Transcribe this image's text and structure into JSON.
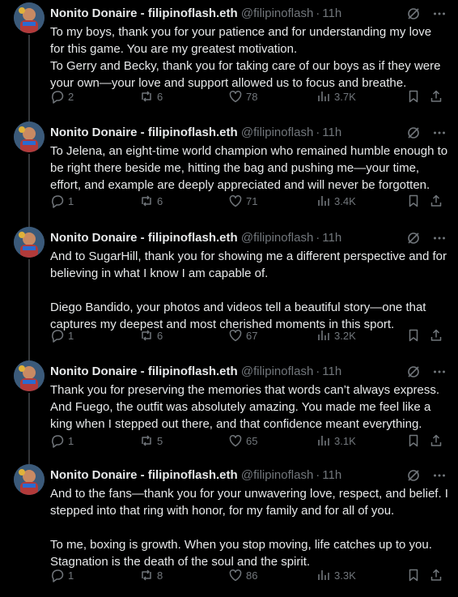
{
  "author": {
    "name": "Nonito Donaire - filipinoflash.eth",
    "handle": "@filipinoflash",
    "separator": "·",
    "time": "11h"
  },
  "colors": {
    "background": "#000000",
    "text": "#e7e9ea",
    "muted": "#71767b",
    "thread_line": "#333639"
  },
  "icons": {
    "reply": "reply-icon",
    "repost": "repost-icon",
    "like": "heart-icon",
    "views": "views-chart-icon",
    "bookmark": "bookmark-icon",
    "share": "share-icon",
    "grok": "grok-icon",
    "more": "more-options-icon"
  },
  "tweets": [
    {
      "paragraphs": [
        "To my boys, thank you for your patience and for understanding my love for this game. You are my greatest motivation.",
        "To Gerry and Becky, thank you for taking care of our boys as if they were your own—your love and support allowed us to focus and breathe."
      ],
      "replies": "2",
      "reposts": "6",
      "likes": "78",
      "views": "3.7K"
    },
    {
      "paragraphs": [
        "To Jelena, an eight-time world champion who remained humble enough to be right there beside me, hitting the bag and pushing me—your time, effort, and example are deeply appreciated and will never be forgotten."
      ],
      "replies": "1",
      "reposts": "6",
      "likes": "71",
      "views": "3.4K"
    },
    {
      "paragraphs": [
        "And to SugarHill, thank you for showing me a different perspective and for believing in what I know I am capable of.",
        "Diego Bandido, your photos and videos tell a beautiful story—one that captures my deepest and most cherished moments in this sport."
      ],
      "replies": "1",
      "reposts": "6",
      "likes": "67",
      "views": "3.2K"
    },
    {
      "paragraphs": [
        "Thank you for preserving the memories that words can’t always express. And Fuego, the outfit was absolutely amazing. You made me feel like a king when I stepped out there, and that confidence meant everything."
      ],
      "replies": "1",
      "reposts": "5",
      "likes": "65",
      "views": "3.1K"
    },
    {
      "paragraphs": [
        "And to the fans—thank you for your unwavering love, respect, and belief. I stepped into that ring with honor, for my family and for all of you.",
        "To me, boxing is growth. When you stop moving, life catches up to you. Stagnation is the death of the soul and the spirit."
      ],
      "replies": "1",
      "reposts": "8",
      "likes": "86",
      "views": "3.3K"
    }
  ]
}
